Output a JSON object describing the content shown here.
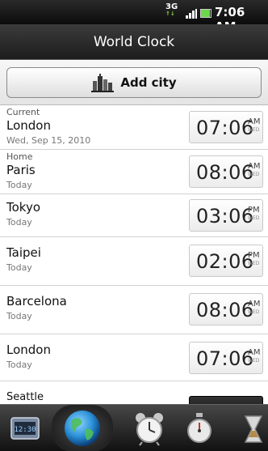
{
  "status": {
    "network": "3G",
    "time": "7:06 AM"
  },
  "title": "World Clock",
  "add_city": {
    "label": "Add city"
  },
  "cities": [
    {
      "tag": "Current",
      "city": "London",
      "sub": "Wed, Sep 15, 2010",
      "time": "07:06",
      "ampm": "AM"
    },
    {
      "tag": "Home",
      "city": "Paris",
      "sub": "Today",
      "time": "08:06",
      "ampm": "AM"
    },
    {
      "tag": "",
      "city": "Tokyo",
      "sub": "Today",
      "time": "03:06",
      "ampm": "PM"
    },
    {
      "tag": "",
      "city": "Taipei",
      "sub": "Today",
      "time": "02:06",
      "ampm": "PM"
    },
    {
      "tag": "",
      "city": "Barcelona",
      "sub": "Today",
      "time": "08:06",
      "ampm": "AM"
    },
    {
      "tag": "",
      "city": "London",
      "sub": "Today",
      "time": "07:06",
      "ampm": "AM"
    },
    {
      "tag": "",
      "city": "Seattle",
      "sub": "",
      "time": "",
      "ampm": ""
    }
  ],
  "tabs": [
    {
      "name": "desk-clock-tab-icon",
      "selected": false
    },
    {
      "name": "world-clock-tab-icon",
      "selected": true
    },
    {
      "name": "alarms-tab-icon",
      "selected": false
    },
    {
      "name": "stopwatch-tab-icon",
      "selected": false
    },
    {
      "name": "timer-tab-icon",
      "selected": false
    }
  ],
  "accent": "#2a8fd6"
}
